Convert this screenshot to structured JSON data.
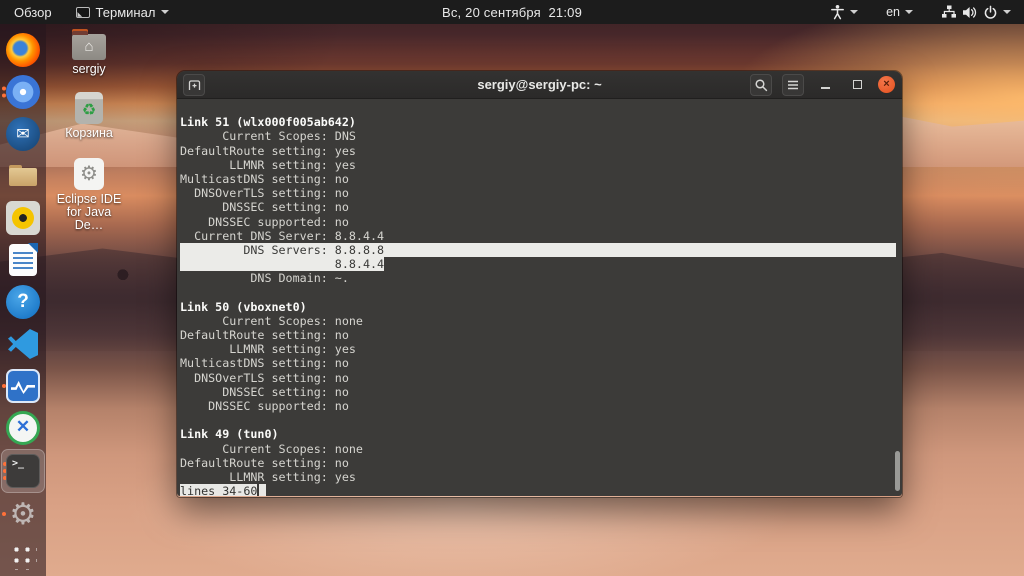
{
  "top_bar": {
    "activities_label": "Обзор",
    "app_menu_label": "Терминал",
    "clock": "Вс, 20 сентября  21:09",
    "keyboard_layout": "en"
  },
  "desktop": {
    "icons": [
      {
        "id": "home",
        "label": "sergiy"
      },
      {
        "id": "trash",
        "label": "Корзина"
      },
      {
        "id": "eclipse",
        "label": "Eclipse IDE for Java De…"
      }
    ]
  },
  "dock": {
    "items": [
      {
        "id": "firefox",
        "dots": 0,
        "active": false
      },
      {
        "id": "chromium",
        "dots": 2,
        "active": false
      },
      {
        "id": "thunderbird",
        "dots": 0,
        "active": false
      },
      {
        "id": "files",
        "dots": 0,
        "active": false
      },
      {
        "id": "rhythmbox",
        "dots": 0,
        "active": false
      },
      {
        "id": "writer",
        "dots": 0,
        "active": false
      },
      {
        "id": "help",
        "dots": 0,
        "active": false
      },
      {
        "id": "vscode",
        "dots": 0,
        "active": false
      },
      {
        "id": "monitor",
        "dots": 1,
        "active": false
      },
      {
        "id": "xapp",
        "dots": 0,
        "active": false
      },
      {
        "id": "terminal",
        "dots": 3,
        "active": true
      },
      {
        "id": "settings",
        "dots": 1,
        "active": false
      },
      {
        "id": "app-grid",
        "dots": 0,
        "active": false
      }
    ]
  },
  "terminal": {
    "title": "sergiy@sergiy-pc: ~",
    "lines": [
      {
        "t": "",
        "s": ""
      },
      {
        "t": "Link 51 (wlx000f005ab642)",
        "s": "bold"
      },
      {
        "t": "      Current Scopes: DNS",
        "s": ""
      },
      {
        "t": "DefaultRoute setting: yes",
        "s": ""
      },
      {
        "t": "       LLMNR setting: yes",
        "s": ""
      },
      {
        "t": "MulticastDNS setting: no",
        "s": ""
      },
      {
        "t": "  DNSOverTLS setting: no",
        "s": ""
      },
      {
        "t": "      DNSSEC setting: no",
        "s": ""
      },
      {
        "t": "    DNSSEC supported: no",
        "s": ""
      },
      {
        "t": "  Current DNS Server: 8.8.4.4",
        "s": ""
      },
      {
        "t": "         DNS Servers: 8.8.8.8",
        "s": "hl-full"
      },
      {
        "t": "                      8.8.4.4",
        "s": "hl-text"
      },
      {
        "t": "          DNS Domain: ~.",
        "s": ""
      },
      {
        "t": "",
        "s": ""
      },
      {
        "t": "Link 50 (vboxnet0)",
        "s": "bold"
      },
      {
        "t": "      Current Scopes: none",
        "s": ""
      },
      {
        "t": "DefaultRoute setting: no",
        "s": ""
      },
      {
        "t": "       LLMNR setting: yes",
        "s": ""
      },
      {
        "t": "MulticastDNS setting: no",
        "s": ""
      },
      {
        "t": "  DNSOverTLS setting: no",
        "s": ""
      },
      {
        "t": "      DNSSEC setting: no",
        "s": ""
      },
      {
        "t": "    DNSSEC supported: no",
        "s": ""
      },
      {
        "t": "",
        "s": ""
      },
      {
        "t": "Link 49 (tun0)",
        "s": "bold"
      },
      {
        "t": "      Current Scopes: none",
        "s": ""
      },
      {
        "t": "DefaultRoute setting: no",
        "s": ""
      },
      {
        "t": "       LLMNR setting: yes",
        "s": ""
      },
      {
        "t": "lines 34-60",
        "s": "status",
        "cursor": true
      }
    ]
  },
  "colors": {
    "accent_orange": "#E95420",
    "indicator_dot": "#FF7139",
    "terminal_background": "#3C3B39",
    "terminal_text": "#D6D5D0",
    "selection_background": "#EBEBE8",
    "topbar_background": "#1C1C1C"
  }
}
